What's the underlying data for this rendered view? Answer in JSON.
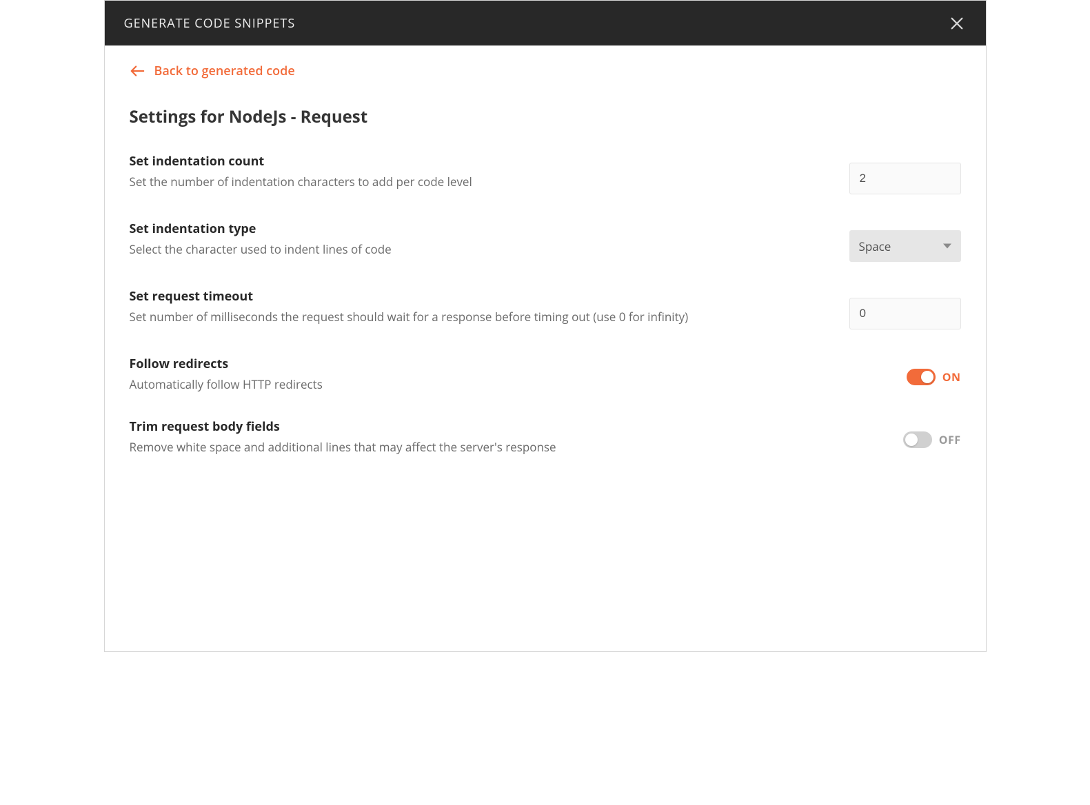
{
  "modal": {
    "title": "GENERATE CODE SNIPPETS"
  },
  "back": {
    "label": "Back to generated code"
  },
  "page_title": "Settings for NodeJs - Request",
  "settings": {
    "indent_count": {
      "label": "Set indentation count",
      "desc": "Set the number of indentation characters to add per code level",
      "value": "2"
    },
    "indent_type": {
      "label": "Set indentation type",
      "desc": "Select the character used to indent lines of code",
      "value": "Space"
    },
    "timeout": {
      "label": "Set request timeout",
      "desc": "Set number of milliseconds the request should wait for a response before timing out (use 0 for infinity)",
      "value": "0"
    },
    "follow_redirects": {
      "label": "Follow redirects",
      "desc": "Automatically follow HTTP redirects",
      "state_label": "ON"
    },
    "trim_body": {
      "label": "Trim request body fields",
      "desc": "Remove white space and additional lines that may affect the server's response",
      "state_label": "OFF"
    }
  }
}
